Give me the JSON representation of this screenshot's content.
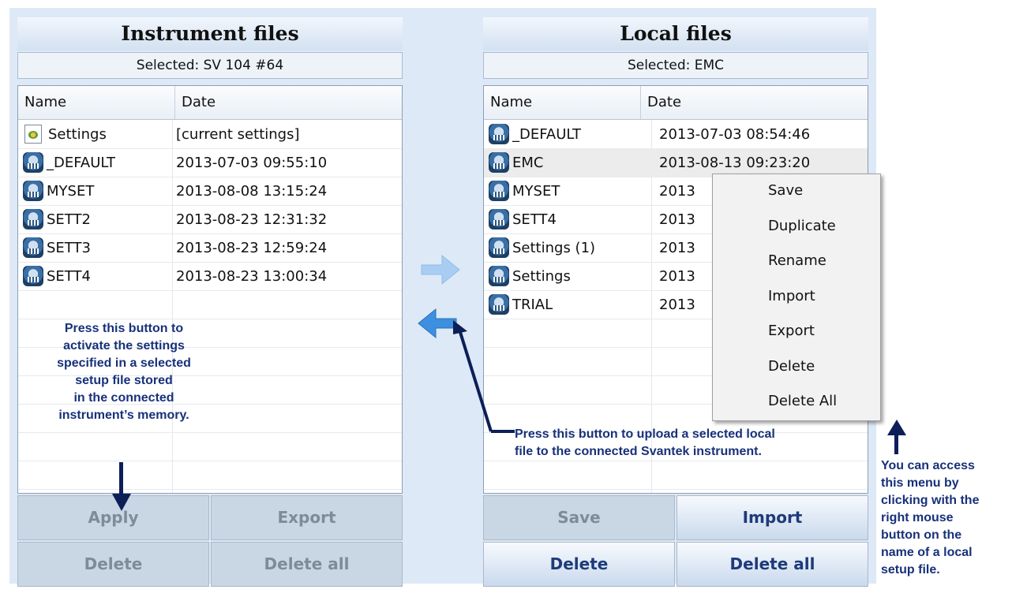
{
  "instrument": {
    "title": "Instrument files",
    "selected": "Selected: SV 104 #64",
    "columns": [
      "Name",
      "Date"
    ],
    "rows": [
      {
        "name": "Settings",
        "date": "[current settings]",
        "icon": "settings-file-icon"
      },
      {
        "name": "_DEFAULT",
        "date": "2013-07-03 09:55:10",
        "icon": "setup-file-icon"
      },
      {
        "name": "MYSET",
        "date": "2013-08-08 13:15:24",
        "icon": "setup-file-icon"
      },
      {
        "name": "SETT2",
        "date": "2013-08-23 12:31:32",
        "icon": "setup-file-icon"
      },
      {
        "name": "SETT3",
        "date": "2013-08-23 12:59:24",
        "icon": "setup-file-icon"
      },
      {
        "name": "SETT4",
        "date": "2013-08-23 13:00:34",
        "icon": "setup-file-icon"
      }
    ],
    "buttons": {
      "apply": "Apply",
      "export": "Export",
      "delete": "Delete",
      "delete_all": "Delete all"
    }
  },
  "local": {
    "title": "Local files",
    "selected": "Selected: EMC",
    "columns": [
      "Name",
      "Date"
    ],
    "rows": [
      {
        "name": "_DEFAULT",
        "date": "2013-07-03 08:54:46"
      },
      {
        "name": "EMC",
        "date": "2013-08-13 09:23:20"
      },
      {
        "name": "MYSET",
        "date": "2013"
      },
      {
        "name": "SETT4",
        "date": "2013"
      },
      {
        "name": "Settings (1)",
        "date": "2013"
      },
      {
        "name": "Settings",
        "date": "2013"
      },
      {
        "name": "TRIAL",
        "date": "2013"
      }
    ],
    "buttons": {
      "save": "Save",
      "import": "Import",
      "delete": "Delete",
      "delete_all": "Delete all"
    }
  },
  "context_menu": {
    "items": [
      "Save",
      "Duplicate",
      "Rename",
      "Import",
      "Export",
      "Delete",
      "Delete All"
    ]
  },
  "annotations": {
    "apply_note": [
      "Press this button to",
      "activate the settings",
      "specified in a selected",
      "setup file stored",
      "in the connected",
      "instrument’s memory."
    ],
    "upload_note": [
      "Press this button to upload a selected local",
      "file to the connected Svantek instrument."
    ],
    "menu_note": [
      "You can access",
      "this menu by",
      "clicking with the",
      "right mouse",
      "button on the",
      "name of a local",
      "setup file."
    ]
  },
  "colors": {
    "annotation_text": "#17317a",
    "enabled_button_text": "#1e3a7a",
    "disabled_button_text": "#7e8b99",
    "arrow_blue": "#3d8fe0"
  }
}
